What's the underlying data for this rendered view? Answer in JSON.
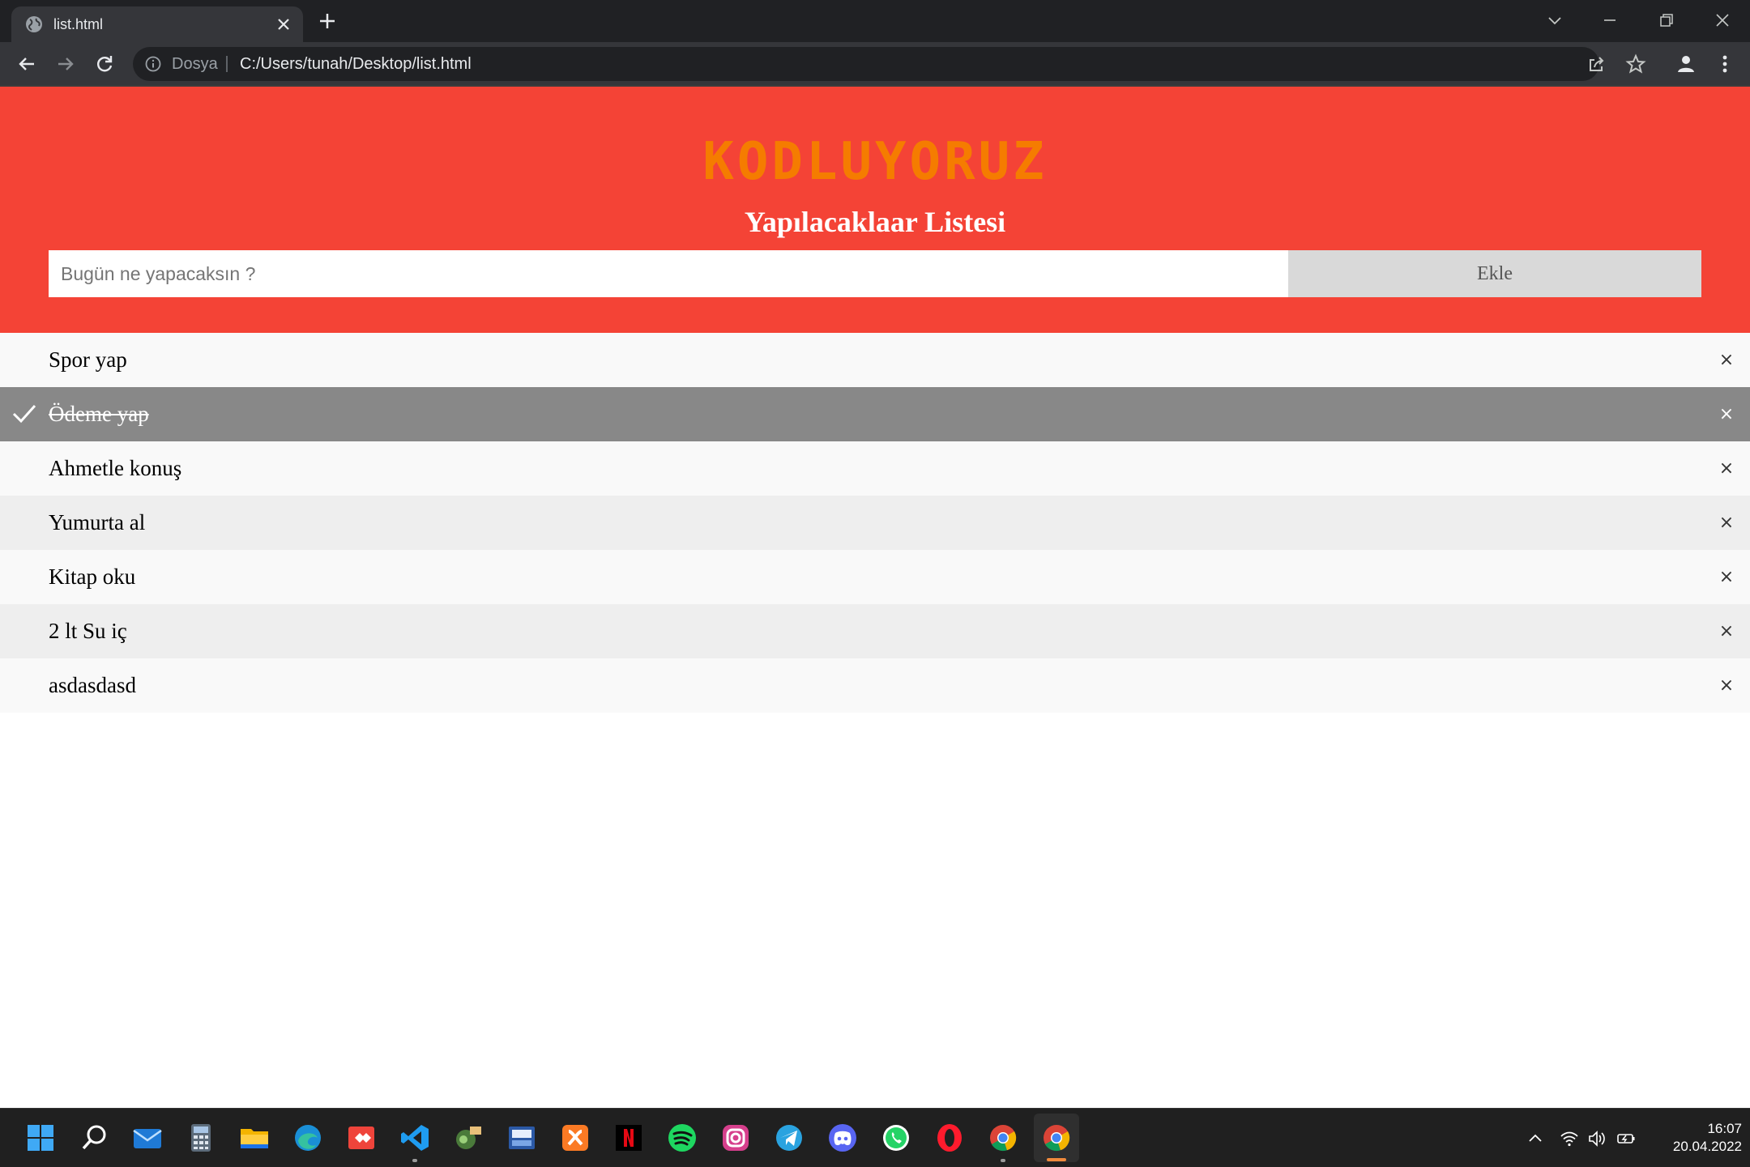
{
  "browser": {
    "tab_title": "list.html",
    "scheme_label": "Dosya",
    "url": "C:/Users/tunah/Desktop/list.html"
  },
  "page": {
    "logo_text": "KODLUYORUZ",
    "title": "Yapılacaklaar Listesi",
    "input_placeholder": "Bugün ne yapacaksın ?",
    "add_button_label": "Ekle",
    "close_symbol": "×",
    "tasks": [
      {
        "text": "Spor yap",
        "done": false
      },
      {
        "text": "Ödeme yap",
        "done": true
      },
      {
        "text": "Ahmetle konuş",
        "done": false
      },
      {
        "text": "Yumurta al",
        "done": false
      },
      {
        "text": "Kitap oku",
        "done": false
      },
      {
        "text": "2 lt Su iç",
        "done": false
      },
      {
        "text": "asdasdasd",
        "done": false
      }
    ]
  },
  "taskbar": {
    "apps": [
      "start-icon",
      "search-icon",
      "mail-icon",
      "calculator-icon",
      "file-explorer-icon",
      "edge-icon",
      "anydesk-icon",
      "vscode-icon",
      "git-icon",
      "devc-icon",
      "xampp-icon",
      "netflix-icon",
      "spotify-icon",
      "instagram-icon",
      "telegram-icon",
      "discord-icon",
      "whatsapp-icon",
      "opera-icon",
      "chrome-icon",
      "chrome-active-icon"
    ],
    "time": "16:07",
    "date": "20.04.2022"
  },
  "colors": {
    "header_bg": "#f44336",
    "logo": "#f57c00",
    "checked_row": "#888888",
    "add_button_bg": "#d9d9d9"
  }
}
